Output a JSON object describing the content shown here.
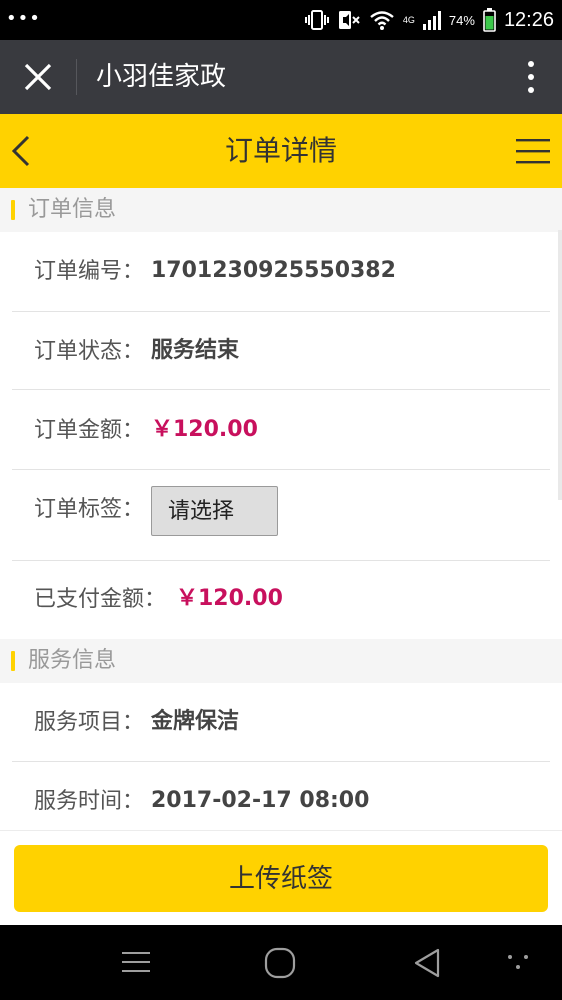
{
  "status_bar": {
    "network_label": "4G",
    "battery_percent": "74%",
    "time": "12:26"
  },
  "wechat_header": {
    "title": "小羽佳家政"
  },
  "page_header": {
    "title": "订单详情"
  },
  "order_info": {
    "section_title": "订单信息",
    "order_number_label": "订单编号：",
    "order_number": "1701230925550382",
    "status_label": "订单状态：",
    "status": "服务结束",
    "amount_label": "订单金额：",
    "amount": "￥120.00",
    "tag_label": "订单标签：",
    "tag_select_value": "请选择",
    "paid_label": "已支付金额：",
    "paid_amount": "￥120.00"
  },
  "service_info": {
    "section_title": "服务信息",
    "item_label": "服务项目：",
    "item": "金牌保洁",
    "time_label": "服务时间：",
    "time": "2017-02-17 08:00"
  },
  "actions": {
    "upload_label": "上传纸签"
  },
  "colors": {
    "accent_yellow": "#ffd200",
    "price_color": "#c8105d",
    "header_dark": "#393a3f"
  }
}
